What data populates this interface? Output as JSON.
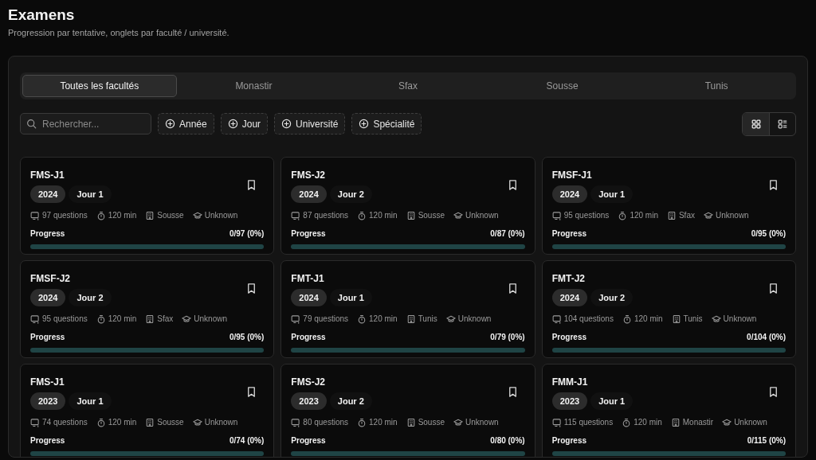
{
  "header": {
    "title": "Examens",
    "subtitle": "Progression par tentative, onglets par faculté / université."
  },
  "tabs": [
    {
      "label": "Toutes les facultés",
      "selected": true
    },
    {
      "label": "Monastir",
      "selected": false
    },
    {
      "label": "Sfax",
      "selected": false
    },
    {
      "label": "Sousse",
      "selected": false
    },
    {
      "label": "Tunis",
      "selected": false
    }
  ],
  "search": {
    "placeholder": "Rechercher..."
  },
  "filters": [
    "Année",
    "Jour",
    "Université",
    "Spécialité"
  ],
  "view_toggle": [
    {
      "kind": "grid",
      "selected": true
    },
    {
      "kind": "list",
      "selected": false
    }
  ],
  "exams": [
    {
      "title": "FMS-J1",
      "year": "2024",
      "day": "Jour 1",
      "questions": "97 questions",
      "duration": "120 min",
      "faculty": "Sousse",
      "specialty": "Unknown",
      "progress_label": "Progress",
      "progress_text": "0/97 (0%)",
      "level": 0
    },
    {
      "title": "FMS-J2",
      "year": "2024",
      "day": "Jour 2",
      "questions": "87 questions",
      "duration": "120 min",
      "faculty": "Sousse",
      "specialty": "Unknown",
      "progress_label": "Progress",
      "progress_text": "0/87 (0%)",
      "level": 0
    },
    {
      "title": "FMSF-J1",
      "year": "2024",
      "day": "Jour 1",
      "questions": "95 questions",
      "duration": "120 min",
      "faculty": "Sfax",
      "specialty": "Unknown",
      "progress_label": "Progress",
      "progress_text": "0/95 (0%)",
      "level": 0
    },
    {
      "title": "FMSF-J2",
      "year": "2024",
      "day": "Jour 2",
      "questions": "95 questions",
      "duration": "120 min",
      "faculty": "Sfax",
      "specialty": "Unknown",
      "progress_label": "Progress",
      "progress_text": "0/95 (0%)",
      "level": 0
    },
    {
      "title": "FMT-J1",
      "year": "2024",
      "day": "Jour 1",
      "questions": "79 questions",
      "duration": "120 min",
      "faculty": "Tunis",
      "specialty": "Unknown",
      "progress_label": "Progress",
      "progress_text": "0/79 (0%)",
      "level": 0
    },
    {
      "title": "FMT-J2",
      "year": "2024",
      "day": "Jour 2",
      "questions": "104 questions",
      "duration": "120 min",
      "faculty": "Tunis",
      "specialty": "Unknown",
      "progress_label": "Progress",
      "progress_text": "0/104 (0%)",
      "level": 0
    },
    {
      "title": "FMS-J1",
      "year": "2023",
      "day": "Jour 1",
      "questions": "74 questions",
      "duration": "120 min",
      "faculty": "Sousse",
      "specialty": "Unknown",
      "progress_label": "Progress",
      "progress_text": "0/74 (0%)",
      "level": 0
    },
    {
      "title": "FMS-J2",
      "year": "2023",
      "day": "Jour 2",
      "questions": "80 questions",
      "duration": "120 min",
      "faculty": "Sousse",
      "specialty": "Unknown",
      "progress_label": "Progress",
      "progress_text": "0/80 (0%)",
      "level": 0
    },
    {
      "title": "FMM-J1",
      "year": "2023",
      "day": "Jour 1",
      "questions": "115 questions",
      "duration": "120 min",
      "faculty": "Monastir",
      "specialty": "Unknown",
      "progress_label": "Progress",
      "progress_text": "0/115 (0%)",
      "level": 0
    }
  ]
}
